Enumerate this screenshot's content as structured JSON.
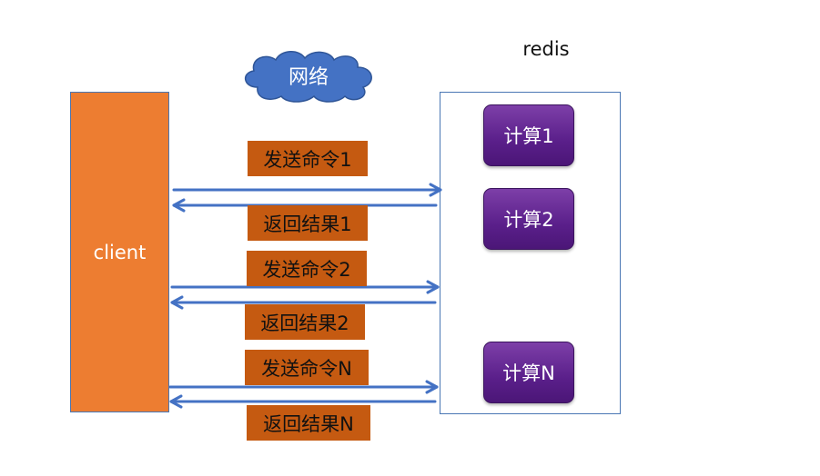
{
  "network": {
    "label": "网络"
  },
  "redis": {
    "label": "redis"
  },
  "client": {
    "label": "client"
  },
  "computations": [
    "计算1",
    "计算2",
    "计算N"
  ],
  "messages": {
    "send_1": "发送命令1",
    "return_1": "返回结果1",
    "send_2": "发送命令2",
    "return_2": "返回结果2",
    "send_n": "发送命令N",
    "return_n": "返回结果N"
  },
  "colors": {
    "client_fill": "#ED7D31",
    "message_fill": "#C55A11",
    "compute_fill": "#5A1F8A",
    "cloud_fill": "#4472C4",
    "arrow": "#4472C4"
  }
}
